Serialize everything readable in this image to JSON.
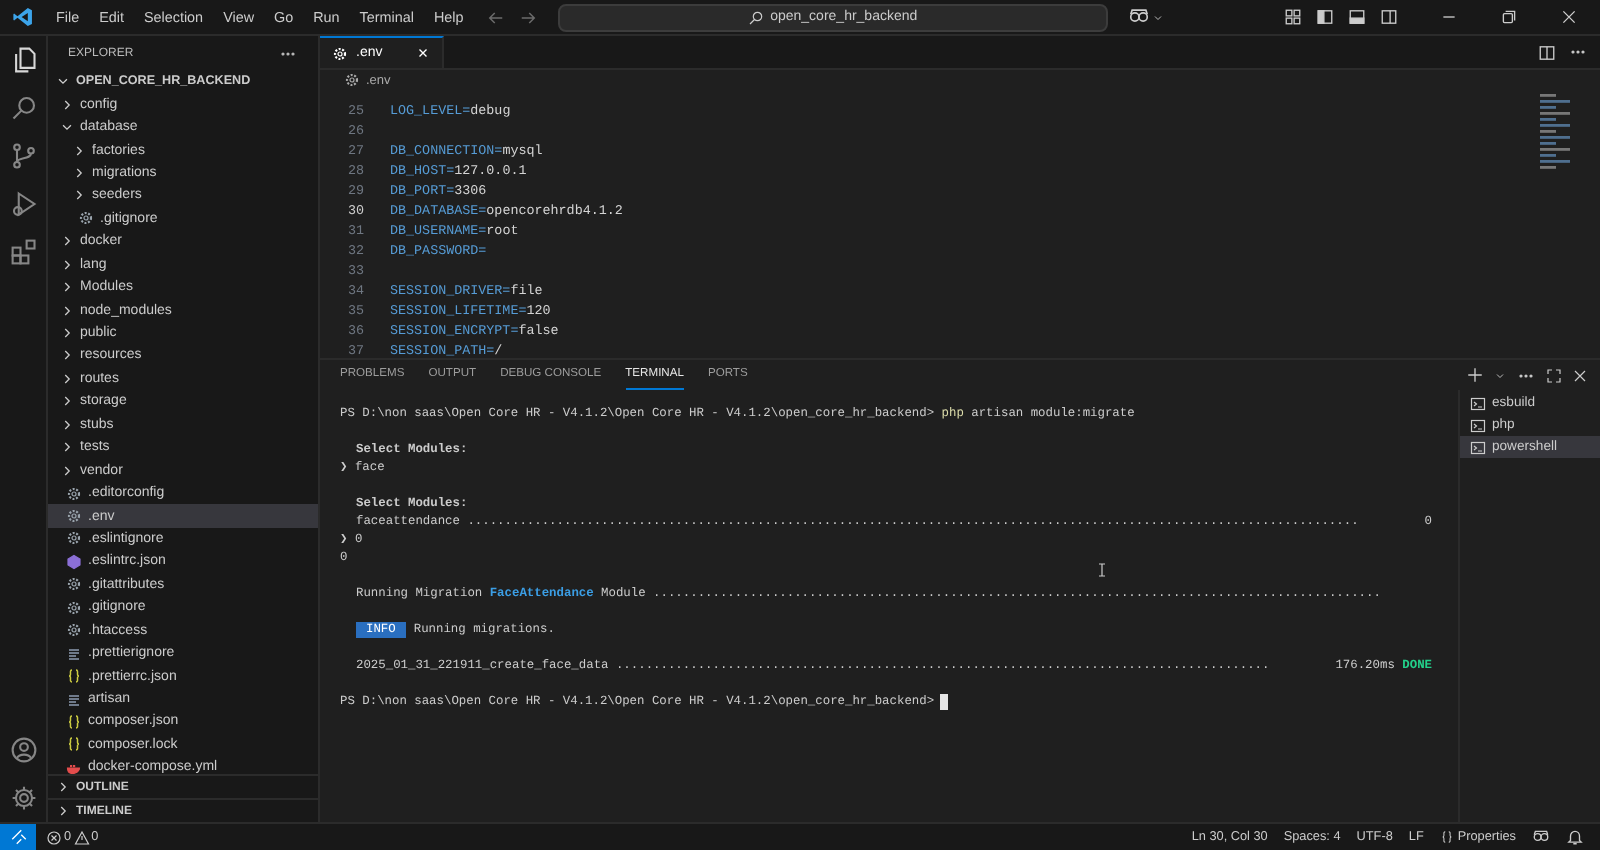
{
  "menu": [
    "File",
    "Edit",
    "Selection",
    "View",
    "Go",
    "Run",
    "Terminal",
    "Help"
  ],
  "command_center": {
    "text": "open_core_hr_backend"
  },
  "activity_bar": [
    {
      "kind": "explorer",
      "selected": true
    },
    {
      "kind": "search",
      "selected": false
    },
    {
      "kind": "source-control",
      "selected": false
    },
    {
      "kind": "run",
      "selected": false
    },
    {
      "kind": "extensions",
      "selected": false
    }
  ],
  "activity_bar_bottom": [
    {
      "kind": "account"
    },
    {
      "kind": "settings"
    }
  ],
  "sidebar": {
    "title": "EXPLORER",
    "project": {
      "name": "OPEN_CORE_HR_BACKEND",
      "expanded": true
    },
    "items": [
      {
        "name": "config",
        "kind": "folder",
        "expanded": false,
        "selected": false
      },
      {
        "name": "database",
        "kind": "folder",
        "expanded": true,
        "selected": false,
        "children": [
          {
            "name": "factories",
            "kind": "folder",
            "expanded": false,
            "selected": false
          },
          {
            "name": "migrations",
            "kind": "folder",
            "expanded": false,
            "selected": false
          },
          {
            "name": "seeders",
            "kind": "folder",
            "expanded": false,
            "selected": false
          },
          {
            "name": ".gitignore",
            "kind": "settings",
            "selected": false
          }
        ]
      },
      {
        "name": "docker",
        "kind": "folder",
        "expanded": false,
        "selected": false
      },
      {
        "name": "lang",
        "kind": "folder",
        "expanded": false,
        "selected": false
      },
      {
        "name": "Modules",
        "kind": "folder",
        "expanded": false,
        "selected": false
      },
      {
        "name": "node_modules",
        "kind": "folder",
        "expanded": false,
        "selected": false
      },
      {
        "name": "public",
        "kind": "folder",
        "expanded": false,
        "selected": false
      },
      {
        "name": "resources",
        "kind": "folder",
        "expanded": false,
        "selected": false
      },
      {
        "name": "routes",
        "kind": "folder",
        "expanded": false,
        "selected": false
      },
      {
        "name": "storage",
        "kind": "folder",
        "expanded": false,
        "selected": false
      },
      {
        "name": "stubs",
        "kind": "folder",
        "expanded": false,
        "selected": false
      },
      {
        "name": "tests",
        "kind": "folder",
        "expanded": false,
        "selected": false
      },
      {
        "name": "vendor",
        "kind": "folder",
        "expanded": false,
        "selected": false
      },
      {
        "name": ".editorconfig",
        "kind": "settings",
        "selected": false
      },
      {
        "name": ".env",
        "kind": "settings",
        "selected": true
      },
      {
        "name": ".eslintignore",
        "kind": "settings",
        "selected": false
      },
      {
        "name": ".eslintrc.json",
        "kind": "eslint",
        "selected": false
      },
      {
        "name": ".gitattributes",
        "kind": "settings",
        "selected": false
      },
      {
        "name": ".gitignore",
        "kind": "settings",
        "selected": false
      },
      {
        "name": ".htaccess",
        "kind": "settings",
        "selected": false
      },
      {
        "name": ".prettierignore",
        "kind": "lines",
        "selected": false
      },
      {
        "name": ".prettierrc.json",
        "kind": "json",
        "selected": false
      },
      {
        "name": "artisan",
        "kind": "lines",
        "selected": false
      },
      {
        "name": "composer.json",
        "kind": "json",
        "selected": false
      },
      {
        "name": "composer.lock",
        "kind": "json",
        "selected": false
      },
      {
        "name": "docker-compose.yml",
        "kind": "docker",
        "selected": false
      }
    ],
    "sections": [
      {
        "title": "OUTLINE",
        "expanded": false
      },
      {
        "title": "TIMELINE",
        "expanded": false
      }
    ]
  },
  "editor": {
    "tabs": [
      {
        "label": ".env",
        "selected": true
      }
    ],
    "breadcrumb": ".env",
    "lines": [
      {
        "number": "25",
        "key": "LOG_LEVEL=",
        "value": "debug",
        "current": false
      },
      {
        "number": "26",
        "current": false
      },
      {
        "number": "27",
        "key": "DB_CONNECTION=",
        "value": "mysql",
        "current": false
      },
      {
        "number": "28",
        "key": "DB_HOST=",
        "value": "127.0.0.1",
        "current": false
      },
      {
        "number": "29",
        "key": "DB_PORT=",
        "value": "3306",
        "current": false
      },
      {
        "number": "30",
        "key": "DB_DATABASE=",
        "value": "opencorehrdb4.1.2",
        "current": true
      },
      {
        "number": "31",
        "key": "DB_USERNAME=",
        "value": "root",
        "current": false
      },
      {
        "number": "32",
        "key": "DB_PASSWORD=",
        "current": false
      },
      {
        "number": "33",
        "current": false
      },
      {
        "number": "34",
        "key": "SESSION_DRIVER=",
        "value": "file",
        "current": false
      },
      {
        "number": "35",
        "key": "SESSION_LIFETIME=",
        "value": "120",
        "current": false
      },
      {
        "number": "36",
        "key": "SESSION_ENCRYPT=",
        "value": "false",
        "current": false
      },
      {
        "number": "37",
        "key": "SESSION_PATH=",
        "value": "/",
        "current": false
      }
    ]
  },
  "panel": {
    "tabs": [
      {
        "label": "PROBLEMS",
        "selected": false
      },
      {
        "label": "OUTPUT",
        "selected": false
      },
      {
        "label": "DEBUG CONSOLE",
        "selected": false
      },
      {
        "label": "TERMINAL",
        "selected": true
      },
      {
        "label": "PORTS",
        "selected": false
      }
    ],
    "terminal_blocks": [
      [
        {
          "kind": "prompt",
          "path": "PS D:\\non saas\\Open Core HR - V4.1.2\\Open Core HR - V4.1.2\\open_core_hr_backend>",
          "command": "php",
          "args": "artisan module:migrate"
        }
      ],
      [
        {
          "kind": "heading",
          "text": "Select Modules:"
        },
        {
          "kind": "choice",
          "marker": "❯",
          "text": "face"
        }
      ],
      [
        {
          "kind": "heading",
          "text": "Select Modules:"
        },
        {
          "kind": "leader",
          "text": "faceattendance",
          "dots": "........................................................................................................................",
          "value": "0"
        },
        {
          "kind": "choice",
          "marker": "❯",
          "text": "0"
        },
        {
          "kind": "plain",
          "text": "0"
        }
      ],
      [
        {
          "kind": "migration",
          "before": "Running Migration",
          "name": "FaceAttendance",
          "after": "Module",
          "dots": ".................................................................................................."
        }
      ],
      [
        {
          "kind": "info",
          "badge": "INFO",
          "text": "Running migrations."
        }
      ],
      [
        {
          "kind": "leader",
          "text": "2025_01_31_221911_create_face_data",
          "dots": "........................................................................................",
          "value": "176.20ms",
          "status": "DONE"
        }
      ],
      [
        {
          "kind": "prompt",
          "path": "PS D:\\non saas\\Open Core HR - V4.1.2\\Open Core HR - V4.1.2\\open_core_hr_backend>",
          "cursor": true
        }
      ]
    ],
    "terminals": [
      {
        "name": "esbuild",
        "selected": false
      },
      {
        "name": "php",
        "selected": false
      },
      {
        "name": "powershell",
        "selected": true
      }
    ]
  },
  "status_bar": {
    "errors": "0",
    "warnings": "0",
    "items": [
      {
        "text": "Ln 30, Col 30",
        "kind": "plain"
      },
      {
        "text": "Spaces: 4",
        "kind": "plain"
      },
      {
        "text": "UTF-8",
        "kind": "plain"
      },
      {
        "text": "LF",
        "kind": "plain"
      },
      {
        "text": "Properties",
        "kind": "braces"
      }
    ]
  }
}
